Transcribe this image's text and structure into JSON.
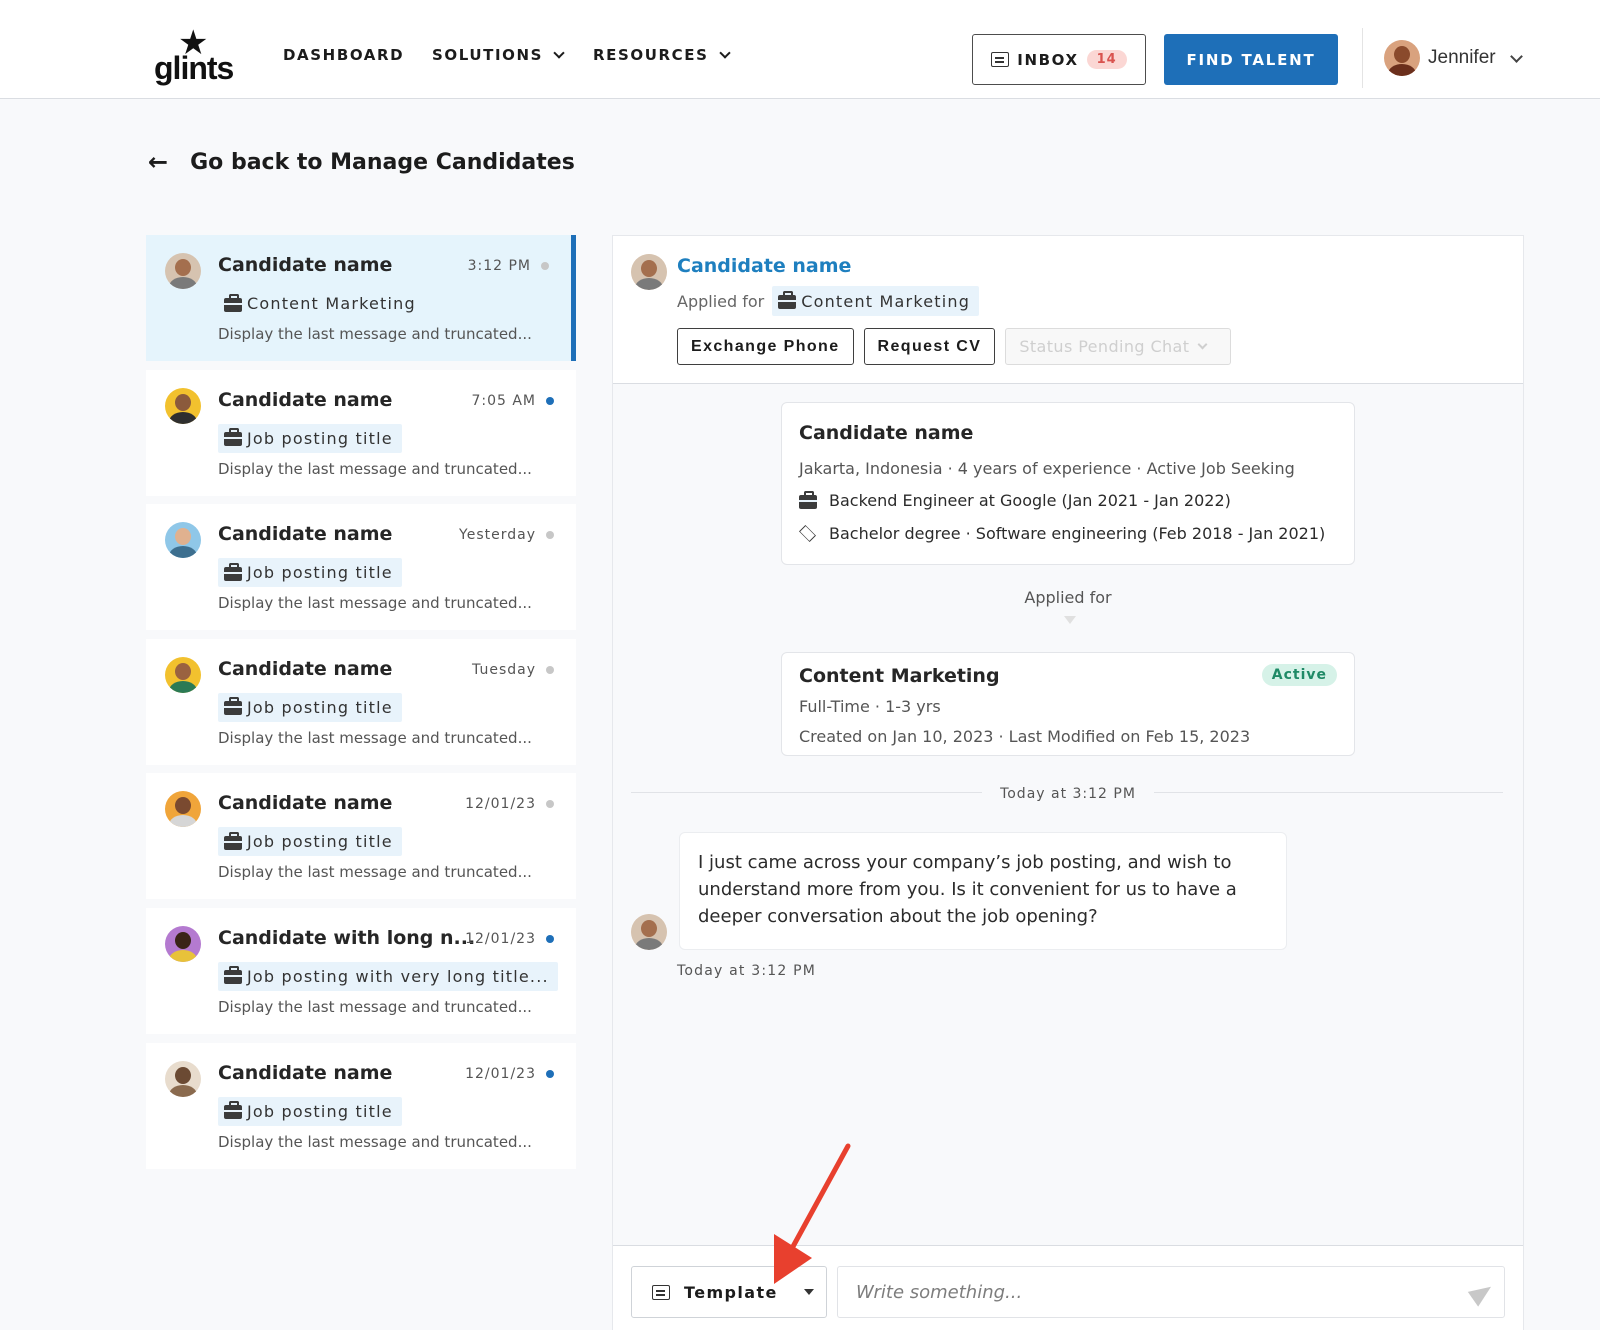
{
  "header": {
    "logo_text": "glints",
    "nav": [
      {
        "label": "DASHBOARD",
        "dropdown": false
      },
      {
        "label": "SOLUTIONS",
        "dropdown": true
      },
      {
        "label": "RESOURCES",
        "dropdown": true
      }
    ],
    "inbox_label": "INBOX",
    "inbox_count": "14",
    "find_talent_label": "FIND TALENT",
    "user_name": "Jennifer"
  },
  "back_link": {
    "label": "Go back to Manage Candidates"
  },
  "candidates": [
    {
      "name": "Candidate name",
      "time": "3:12 PM",
      "unread": false,
      "job": "Content Marketing",
      "message": "Display the last message and truncated...",
      "active": true
    },
    {
      "name": "Candidate name",
      "time": "7:05 AM",
      "unread": true,
      "job": "Job posting title",
      "message": "Display the last message and truncated...",
      "active": false
    },
    {
      "name": "Candidate name",
      "time": "Yesterday",
      "unread": false,
      "job": "Job posting title",
      "message": "Display the last message and truncated...",
      "active": false
    },
    {
      "name": "Candidate name",
      "time": "Tuesday",
      "unread": false,
      "job": "Job posting title",
      "message": "Display the last message and truncated...",
      "active": false
    },
    {
      "name": "Candidate name",
      "time": "12/01/23",
      "unread": false,
      "job": "Job posting title",
      "message": "Display the last message and truncated...",
      "active": false
    },
    {
      "name": "Candidate with long n...",
      "time": "12/01/23",
      "unread": true,
      "job": "Job posting with very long title...",
      "message": "Display the last message and truncated...",
      "active": false
    },
    {
      "name": "Candidate name",
      "time": "12/01/23",
      "unread": true,
      "job": "Job posting title",
      "message": "Display the last message and truncated...",
      "active": false
    }
  ],
  "chat": {
    "candidate_name": "Candidate name",
    "applied_for_label": "Applied for",
    "applied_job": "Content Marketing",
    "buttons": {
      "exchange_phone": "Exchange Phone",
      "request_cv": "Request CV",
      "status": "Status Pending Chat"
    },
    "profile": {
      "name": "Candidate name",
      "meta": "Jakarta, Indonesia ·  4 years of experience ·  Active Job Seeking",
      "work": "Backend Engineer at Google (Jan 2021 - Jan 2022)",
      "education": "Bachelor degree · Software engineering (Feb 2018 - Jan 2021)"
    },
    "applied_for_center": "Applied for",
    "job_card": {
      "title": "Content Marketing",
      "status": "Active",
      "type": "Full-Time · 1-3 yrs",
      "dates": "Created on Jan 10, 2023 · Last Modified on Feb 15, 2023"
    },
    "divider_label": "Today at 3:12 PM",
    "message": {
      "text": "I just came across your company’s job posting, and wish to understand more from you. Is it convenient for us to have a deeper conversation about the job opening?",
      "time": "Today at 3:12 PM"
    },
    "composer": {
      "template_label": "Template",
      "placeholder": "Write something..."
    }
  },
  "colors": {
    "brand_blue": "#1e6fb8",
    "link_blue": "#1e7fbf",
    "active_bg": "#e5f4fc",
    "status_active": "#1f8a66",
    "annotation_red": "#e8402e"
  },
  "icons": [
    "star-logo-icon",
    "chevron-down-icon",
    "chat-icon",
    "avatar",
    "back-arrow-icon",
    "briefcase-icon",
    "graduation-cap-icon",
    "send-icon",
    "caret-down-icon"
  ]
}
